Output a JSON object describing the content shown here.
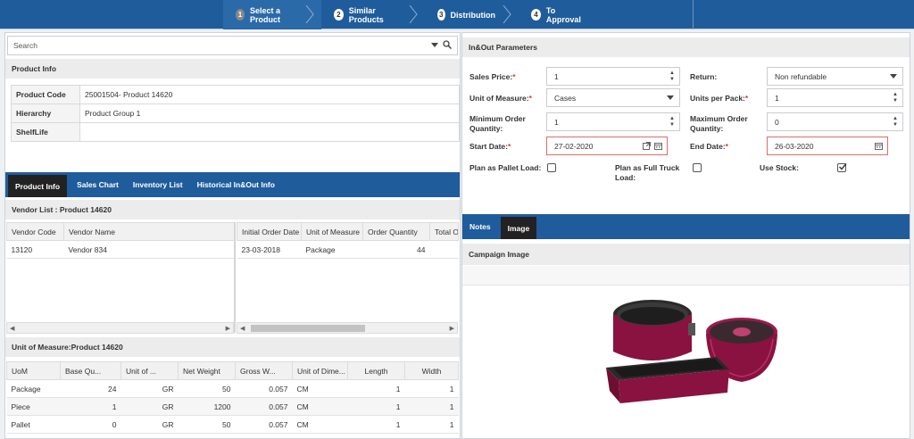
{
  "wizard": {
    "steps": [
      {
        "num": "1",
        "label": "Select a Product",
        "active": true
      },
      {
        "num": "2",
        "label": "Similar Products",
        "active": false
      },
      {
        "num": "3",
        "label": "Distribution",
        "active": false
      },
      {
        "num": "4",
        "label": "To Approval",
        "active": false
      }
    ]
  },
  "search": {
    "placeholder": "Search"
  },
  "product_info": {
    "header": "Product Info",
    "rows": [
      {
        "key": "Product Code",
        "value": "25001504- Product 14620"
      },
      {
        "key": "Hierarchy",
        "value": "Product Group 1"
      },
      {
        "key": "ShelfLife",
        "value": ""
      }
    ]
  },
  "left_tabs": [
    "Product Info",
    "Sales Chart",
    "Inventory List",
    "Historical In&Out Info"
  ],
  "vendor_list": {
    "header": "Vendor List : Product 14620",
    "left_columns": [
      "Vendor Code",
      "Vendor Name"
    ],
    "left_rows": [
      [
        "13120",
        "Vendor 834"
      ]
    ],
    "right_columns": [
      "Initial Order Date",
      "Unit of Measure",
      "Order Quantity",
      "Total O"
    ],
    "right_rows": [
      [
        "23-03-2018",
        "Package",
        "44",
        ""
      ]
    ]
  },
  "uom": {
    "header": "Unit of Measure:Product 14620",
    "columns": [
      "UoM",
      "Base Qu...",
      "Unit of ...",
      "Net Weight",
      "Gross W...",
      "Unit of Dime...",
      "Length",
      "Width"
    ],
    "rows": [
      [
        "Package",
        "24",
        "GR",
        "50",
        "0.057",
        "CM",
        "1",
        "1"
      ],
      [
        "Piece",
        "1",
        "GR",
        "1200",
        "0.057",
        "CM",
        "1",
        "1"
      ],
      [
        "Pallet",
        "0",
        "GR",
        "50",
        "0.057",
        "CM",
        "1",
        "1"
      ]
    ]
  },
  "inout": {
    "header": "In&Out Parameters",
    "sales_price": {
      "label": "Sales Price:",
      "value": "1"
    },
    "return": {
      "label": "Return:",
      "value": "Non refundable"
    },
    "unit_of_measure": {
      "label": "Unit of Measure:",
      "value": "Cases"
    },
    "units_per_pack": {
      "label": "Units per Pack:",
      "value": "1"
    },
    "min_order": {
      "label1": "Minimum Order",
      "label2": "Quantity:",
      "value": "1"
    },
    "max_order": {
      "label1": "Maximum Order",
      "label2": "Quantity:",
      "value": "0"
    },
    "start_date": {
      "label": "Start Date:",
      "value": "27-02-2020"
    },
    "end_date": {
      "label": "End Date:",
      "value": "26-03-2020"
    },
    "pallet_load": {
      "label": "Plan as Pallet Load:",
      "checked": false
    },
    "truck_load": {
      "label1": "Plan as Full Truck",
      "label2": "Load:",
      "checked": false
    },
    "use_stock": {
      "label": "Use Stock:",
      "checked": true
    },
    "required_mark": "*"
  },
  "right_tabs": [
    "Notes",
    "Image"
  ],
  "campaign": {
    "header": "Campaign Image"
  },
  "colors": {
    "primary": "#1f5c9b",
    "dark_tab": "#222222",
    "error": "#e36a6a",
    "product": "#8a1240"
  }
}
